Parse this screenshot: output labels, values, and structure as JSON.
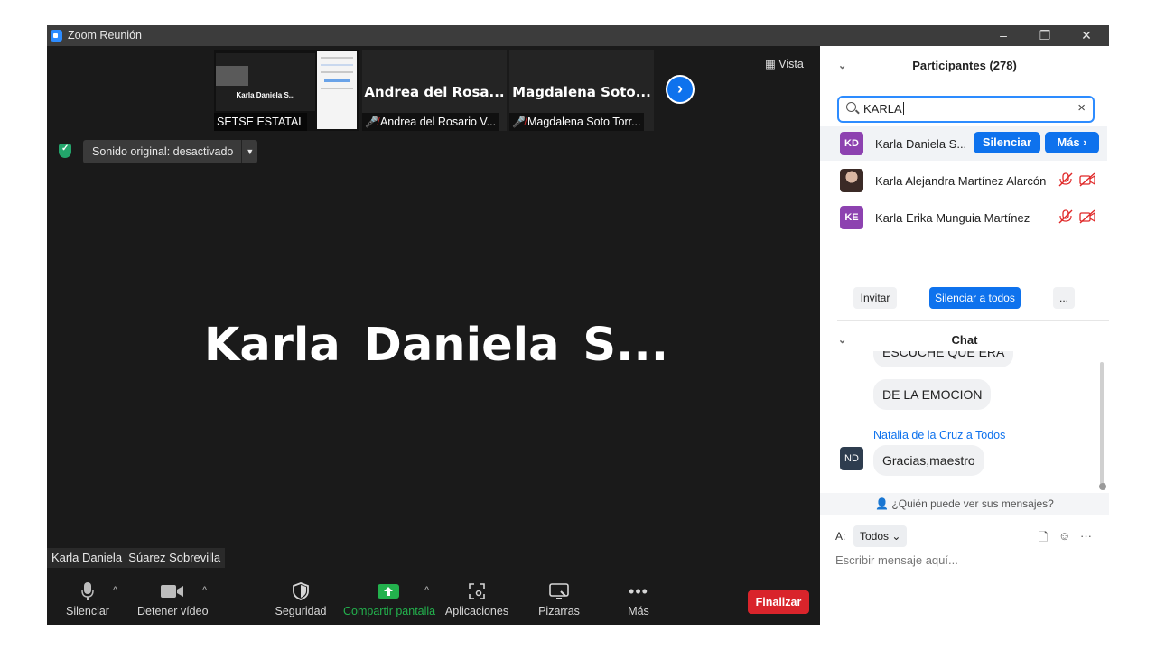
{
  "window": {
    "title": "Zoom Reunión",
    "minimize": "–",
    "restore": "❐",
    "close": "✕"
  },
  "meeting": {
    "view_label": "Vista",
    "thumbnails": [
      {
        "tile_name": "Karla Daniela  S...",
        "label": "SETSE ESTATAL",
        "muted": false
      },
      {
        "tile_name": "Andrea del Rosa...",
        "label": "Andrea del Rosario V...",
        "muted": true
      },
      {
        "tile_name": "Magdalena  Soto...",
        "label": "Magdalena Soto Torr...",
        "muted": true
      }
    ],
    "sound_original": "Sonido original: desactivado",
    "active_speaker_big": "Karla Daniela  S...",
    "active_speaker_label": "Karla Daniela  Súarez Sobrevilla"
  },
  "toolbar": {
    "mute": "Silenciar",
    "stop_video": "Detener vídeo",
    "security": "Seguridad",
    "share": "Compartir pantalla",
    "apps": "Aplicaciones",
    "whiteboards": "Pizarras",
    "more": "Más",
    "end": "Finalizar",
    "share_color": "#23b14d",
    "end_color": "#d9242b"
  },
  "participants": {
    "header": "Participantes (278)",
    "search_value": "KARLA",
    "list": [
      {
        "initials": "KD",
        "name": "Karla Daniela  S...",
        "has_photo": false,
        "color": "#8d42b0"
      },
      {
        "initials": "",
        "name": "Karla Alejandra Martínez Alarcón",
        "has_photo": true,
        "color": "#3b2a26"
      },
      {
        "initials": "KE",
        "name": "Karla Erika Munguia Martínez",
        "has_photo": false,
        "color": "#8d42b0"
      }
    ],
    "mute_btn": "Silenciar",
    "more_btn": "Más",
    "invite": "Invitar",
    "mute_all": "Silenciar a todos",
    "more_dots": "..."
  },
  "chat": {
    "header": "Chat",
    "messages": [
      {
        "text": "ESCUCHE QUE ERA"
      },
      {
        "text": "DE LA EMOCION"
      }
    ],
    "sender": "Natalia de la Cruz a Todos",
    "sender_initials": "ND",
    "last_message": "Gracias,maestro",
    "who_can_see": "¿Quién puede ver sus mensajes?",
    "to_label": "A:",
    "to_value": "Todos",
    "placeholder": "Escribir mensaje aquí..."
  },
  "accent_color": "#0e72ed"
}
